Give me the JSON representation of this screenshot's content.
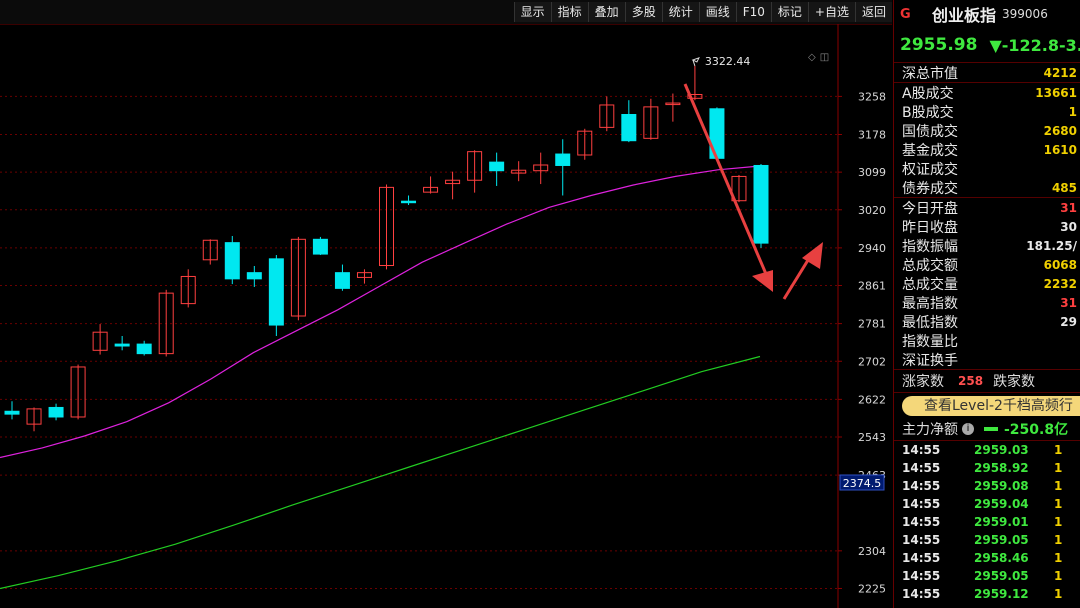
{
  "toolbar": {
    "buttons": [
      "显示",
      "指标",
      "叠加",
      "多股",
      "统计",
      "画线",
      "F10",
      "标记",
      "+自选",
      "返回"
    ]
  },
  "chart_data": {
    "type": "candlestick",
    "y_ticks": [
      3258,
      3178,
      3099,
      3020,
      2940,
      2861,
      2781,
      2702,
      2622,
      2543,
      2463,
      2304,
      2225
    ],
    "ylim": [
      2184,
      3410
    ],
    "high_label": "3322.44",
    "current_price_label": "2374.5",
    "up_color": "#ff4040",
    "down_color": "#00e8f0",
    "candles": [
      {
        "o": 2597,
        "c": 2591,
        "h": 2618,
        "l": 2580
      },
      {
        "o": 2570,
        "c": 2602,
        "h": 2605,
        "l": 2555
      },
      {
        "o": 2605,
        "c": 2585,
        "h": 2613,
        "l": 2578
      },
      {
        "o": 2585,
        "c": 2690,
        "h": 2695,
        "l": 2580
      },
      {
        "o": 2725,
        "c": 2763,
        "h": 2780,
        "l": 2716
      },
      {
        "o": 2738,
        "c": 2734,
        "h": 2755,
        "l": 2725
      },
      {
        "o": 2738,
        "c": 2718,
        "h": 2745,
        "l": 2714
      },
      {
        "o": 2718,
        "c": 2845,
        "h": 2852,
        "l": 2712
      },
      {
        "o": 2823,
        "c": 2880,
        "h": 2895,
        "l": 2815
      },
      {
        "o": 2915,
        "c": 2956,
        "h": 2958,
        "l": 2905
      },
      {
        "o": 2951,
        "c": 2875,
        "h": 2965,
        "l": 2864
      },
      {
        "o": 2888,
        "c": 2875,
        "h": 2902,
        "l": 2858
      },
      {
        "o": 2917,
        "c": 2778,
        "h": 2925,
        "l": 2755
      },
      {
        "o": 2797,
        "c": 2958,
        "h": 2963,
        "l": 2788
      },
      {
        "o": 2958,
        "c": 2927,
        "h": 2963,
        "l": 2925
      },
      {
        "o": 2888,
        "c": 2855,
        "h": 2905,
        "l": 2850
      },
      {
        "o": 2878,
        "c": 2888,
        "h": 2895,
        "l": 2865
      },
      {
        "o": 2903,
        "c": 3067,
        "h": 3073,
        "l": 2895
      },
      {
        "o": 3038,
        "c": 3035,
        "h": 3050,
        "l": 3030
      },
      {
        "o": 3057,
        "c": 3067,
        "h": 3090,
        "l": 3054
      },
      {
        "o": 3075,
        "c": 3082,
        "h": 3100,
        "l": 3042
      },
      {
        "o": 3082,
        "c": 3142,
        "h": 3145,
        "l": 3056
      },
      {
        "o": 3120,
        "c": 3102,
        "h": 3140,
        "l": 3070
      },
      {
        "o": 3097,
        "c": 3103,
        "h": 3122,
        "l": 3080
      },
      {
        "o": 3102,
        "c": 3114,
        "h": 3140,
        "l": 3074
      },
      {
        "o": 3137,
        "c": 3113,
        "h": 3168,
        "l": 3050
      },
      {
        "o": 3135,
        "c": 3185,
        "h": 3190,
        "l": 3125
      },
      {
        "o": 3193,
        "c": 3240,
        "h": 3258,
        "l": 3185
      },
      {
        "o": 3220,
        "c": 3165,
        "h": 3250,
        "l": 3162
      },
      {
        "o": 3170,
        "c": 3236,
        "h": 3253,
        "l": 3167
      },
      {
        "o": 3244,
        "c": 3244,
        "h": 3264,
        "l": 3205
      },
      {
        "o": 3254,
        "c": 3262,
        "h": 3322,
        "l": 3250
      },
      {
        "o": 3232,
        "c": 3128,
        "h": 3235,
        "l": 3122
      },
      {
        "o": 3039,
        "c": 3090,
        "h": 3093,
        "l": 3036
      },
      {
        "o": 3113,
        "c": 2950,
        "h": 3116,
        "l": 2940
      }
    ],
    "ma_series": [
      {
        "name": "ma-short",
        "color": "#dd22dd",
        "values": [
          2500,
          2520,
          2545,
          2575,
          2615,
          2665,
          2720,
          2765,
          2810,
          2860,
          2910,
          2950,
          2990,
          3025,
          3050,
          3072,
          3090,
          3104,
          3112
        ]
      },
      {
        "name": "ma-long",
        "color": "#22cc22",
        "values": [
          2225,
          2252,
          2283,
          2318,
          2358,
          2400,
          2440,
          2480,
          2520,
          2560,
          2600,
          2640,
          2680,
          2712
        ]
      }
    ],
    "arrow_color": "#e84040"
  },
  "panel": {
    "logo": "G",
    "name": "创业板指",
    "code": "399006",
    "price": "2955.98",
    "change": "▼-122.8",
    "change_pct": "-3.",
    "stats_a": [
      {
        "label": "深总市值",
        "value": "4212",
        "cls": "yellow"
      }
    ],
    "stats_b": [
      {
        "label": "A股成交",
        "value": "13661",
        "cls": "yellow"
      },
      {
        "label": "B股成交",
        "value": "1",
        "cls": "yellow"
      },
      {
        "label": "国债成交",
        "value": "2680",
        "cls": "yellow"
      },
      {
        "label": "基金成交",
        "value": "1610",
        "cls": "yellow"
      },
      {
        "label": "权证成交",
        "value": "",
        "cls": "yellow"
      },
      {
        "label": "债券成交",
        "value": "485",
        "cls": "yellow"
      }
    ],
    "stats_c": [
      {
        "label": "今日开盘",
        "value": "31",
        "cls": "red"
      },
      {
        "label": "昨日收盘",
        "value": "30",
        "cls": ""
      },
      {
        "label": "指数振幅",
        "value": "181.25/",
        "cls": ""
      },
      {
        "label": "总成交额",
        "value": "6068",
        "cls": "yellow"
      },
      {
        "label": "总成交量",
        "value": "2232",
        "cls": "yellow"
      },
      {
        "label": "最高指数",
        "value": "31",
        "cls": "red"
      },
      {
        "label": "最低指数",
        "value": "29",
        "cls": ""
      },
      {
        "label": "指数量比",
        "value": "",
        "cls": ""
      },
      {
        "label": "深证换手",
        "value": "",
        "cls": ""
      }
    ],
    "up_label": "涨家数",
    "up_count": "258",
    "down_label": "跌家数",
    "level2": "查看Level-2千档高频行",
    "flow_label": "主力净额",
    "flow_value": "-250.8亿",
    "ticks": [
      {
        "time": "14:55",
        "price": "2959.03",
        "vol": "1"
      },
      {
        "time": "14:55",
        "price": "2958.92",
        "vol": "1"
      },
      {
        "time": "14:55",
        "price": "2959.08",
        "vol": "1"
      },
      {
        "time": "14:55",
        "price": "2959.04",
        "vol": "1"
      },
      {
        "time": "14:55",
        "price": "2959.01",
        "vol": "1"
      },
      {
        "time": "14:55",
        "price": "2959.05",
        "vol": "1"
      },
      {
        "time": "14:55",
        "price": "2958.46",
        "vol": "1"
      },
      {
        "time": "14:55",
        "price": "2959.05",
        "vol": "1"
      },
      {
        "time": "14:55",
        "price": "2959.12",
        "vol": "1"
      }
    ]
  }
}
